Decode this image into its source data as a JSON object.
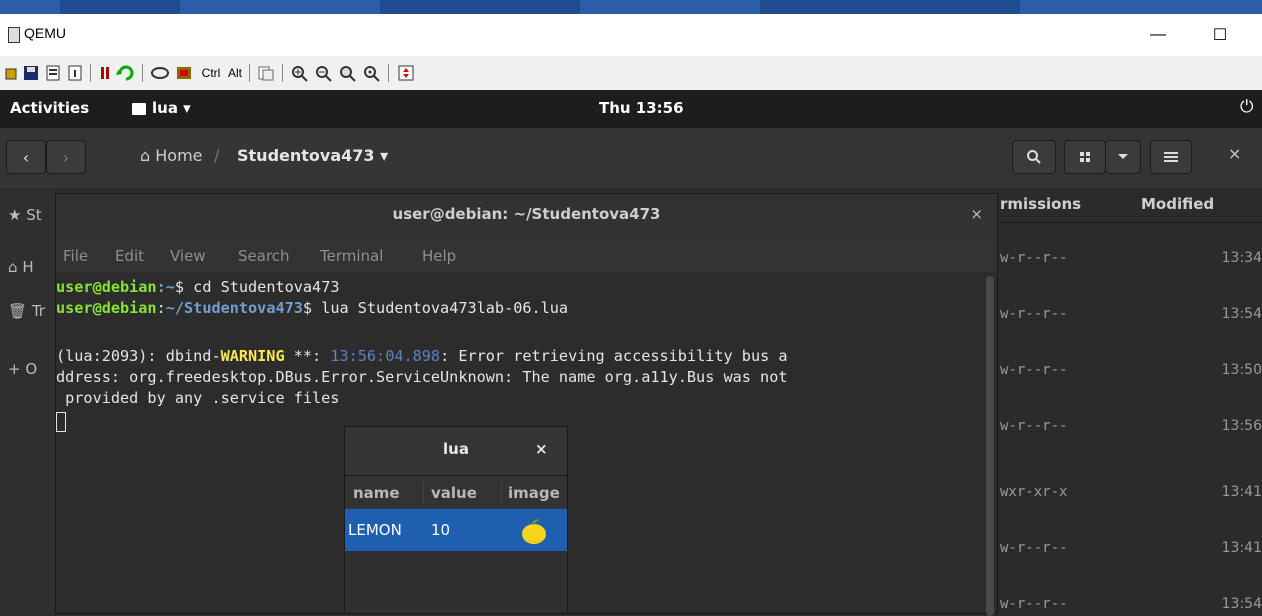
{
  "qemu": {
    "title": "QEMU",
    "minimize": "—",
    "maximize": "☐",
    "toolbar": {
      "ctrl_label": "Ctrl",
      "alt_label": "Alt"
    }
  },
  "gnome": {
    "activities": "Activities",
    "app_menu": "lua ▾",
    "clock": "Thu 13:56",
    "power_icon": "⏻"
  },
  "nautilus": {
    "breadcrumb_home": "⌂ Home",
    "breadcrumb_sep": "/",
    "breadcrumb_current": "Studentova473 ▾",
    "columns": {
      "permissions": "rmissions",
      "modified": "Modified"
    },
    "rows": [
      {
        "perm": "w-r--r--",
        "modified": "13:34"
      },
      {
        "perm": "w-r--r--",
        "modified": "13:54"
      },
      {
        "perm": "w-r--r--",
        "modified": "13:50"
      },
      {
        "perm": "w-r--r--",
        "modified": "13:56"
      },
      {
        "perm": "wxr-xr-x",
        "modified": "13:41"
      },
      {
        "perm": "w-r--r--",
        "modified": "13:41"
      },
      {
        "perm": "w-r--r--",
        "modified": "13:54"
      }
    ],
    "sidebar": [
      {
        "icon": "★",
        "label": "St"
      },
      {
        "icon": "⌂",
        "label": "H"
      },
      {
        "icon": "🗑",
        "label": "Tr"
      },
      {
        "icon": "+",
        "label": "O"
      }
    ]
  },
  "terminal": {
    "title": "user@debian: ~/Studentova473",
    "close": "×",
    "menu": [
      "File",
      "Edit",
      "View",
      "Search",
      "Terminal",
      "Help"
    ],
    "lines": {
      "l1_user": "user@debian",
      "l1_path": ":~",
      "l1_cmd": "$ cd Studentova473",
      "l2_user": "user@debian",
      "l2_colon": ":",
      "l2_path": "~/Studentova473",
      "l2_cmd": "$ lua Studentova473lab-06.lua",
      "l3_pre": "(lua:2093): dbind-",
      "l3_warn": "WARNING",
      "l3_mid": " **: ",
      "l3_time": "13:56:04.898",
      "l3_post": ": Error retrieving accessibility bus a",
      "l4": "ddress: org.freedesktop.DBus.Error.ServiceUnknown: The name org.a11y.Bus was not",
      "l5": " provided by any .service files"
    }
  },
  "lua_dialog": {
    "title": "lua",
    "close": "×",
    "columns": [
      "name",
      "value",
      "image"
    ],
    "row": {
      "name": "LEMON",
      "value": "10",
      "image": "lemon-icon"
    }
  },
  "colors": {
    "selection": "#1f5fb0",
    "prompt_green": "#8ae234",
    "prompt_blue": "#729fcf",
    "warning_yellow": "#fce94f"
  }
}
